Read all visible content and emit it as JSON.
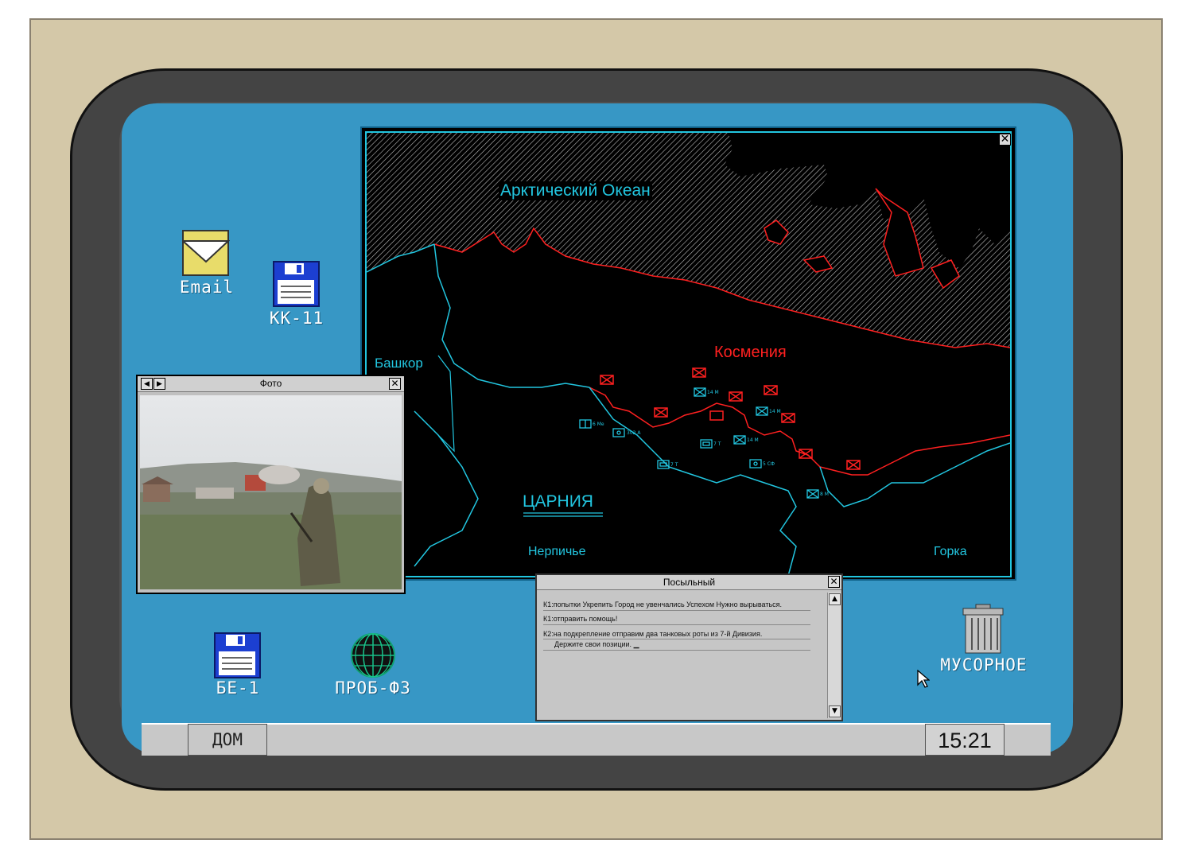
{
  "desktop": {
    "icons": {
      "email": "Email",
      "kk11": "КК-11",
      "be1": "БЕ-1",
      "prob": "ПРОБ-ФЗ",
      "trash": "МУСОРНОЕ"
    }
  },
  "map_window": {
    "labels": {
      "ocean": "Арктический Океан",
      "kosmenia": "Космения",
      "bashkor": "Башкор",
      "tsarnia": "ЦАРНИЯ",
      "nerpiche": "Нерпичье",
      "gorka": "Горка"
    },
    "units": [
      {
        "label": "6 Ме"
      },
      {
        "label": "302 А"
      },
      {
        "label": "14 М"
      },
      {
        "label": "14 М"
      },
      {
        "label": "7 Т"
      },
      {
        "label": "14 М"
      },
      {
        "label": "7 Т"
      },
      {
        "label": "5 СФ"
      },
      {
        "label": "8 М"
      }
    ],
    "colors": {
      "friendly": "#22c6e0",
      "enemy": "#ff2020",
      "ocean_hatch": "#bbbbbb"
    }
  },
  "photo_window": {
    "title": "Фото"
  },
  "messenger": {
    "title": "Посыльный",
    "lines": [
      "К1:попытки Укрепить Город не увенчались Успехом Нужно вырываться.",
      "К1:отправить помощь!",
      "К2:на подкрепление отправим два танковых роты из 7-й Дивизия.",
      "Держите свои позиции."
    ]
  },
  "taskbar": {
    "home_label": "ДОМ",
    "clock": "15:21"
  }
}
